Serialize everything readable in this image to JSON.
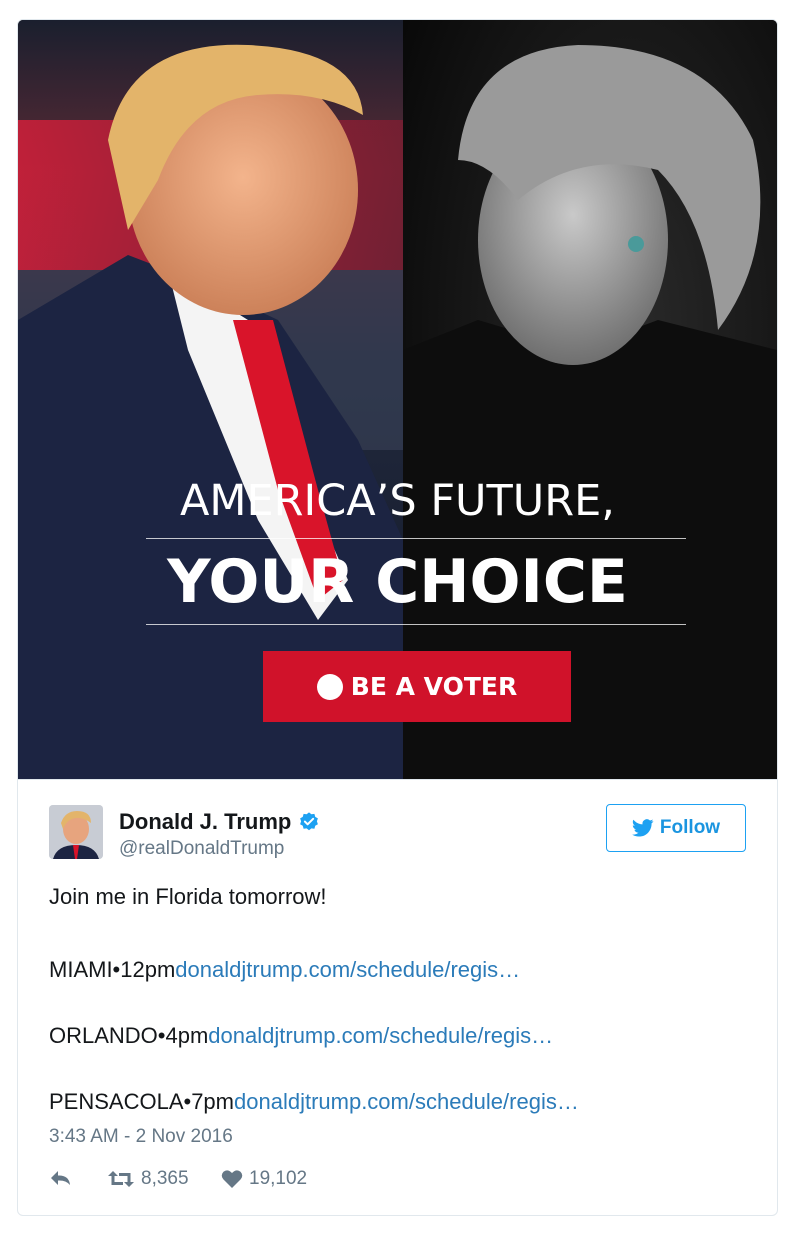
{
  "media": {
    "headline_line1": "AMERICA’S FUTURE,",
    "headline_line2": "YOUR CHOICE",
    "cta_label": "BE A VOTER"
  },
  "author": {
    "name": "Donald J. Trump",
    "handle": "@realDonaldTrump",
    "verified": true
  },
  "follow_button": {
    "label": "Follow"
  },
  "tweet": {
    "intro": "Join me in Florida tomorrow!",
    "lines": [
      {
        "text": "MIAMI•12pm",
        "link": "donaldjtrump.com/schedule/regis…"
      },
      {
        "text": "ORLANDO•4pm",
        "link": "donaldjtrump.com/schedule/regis…"
      },
      {
        "text": "PENSACOLA•7pm",
        "link": "donaldjtrump.com/schedule/regis…"
      }
    ],
    "timestamp": "3:43 AM - 2 Nov 2016"
  },
  "actions": {
    "retweets": "8,365",
    "likes": "19,102"
  },
  "colors": {
    "link": "#2b7bb9",
    "twitter_blue": "#1da1f2",
    "cta_red": "#d0122a",
    "meta_gray": "#657786"
  }
}
